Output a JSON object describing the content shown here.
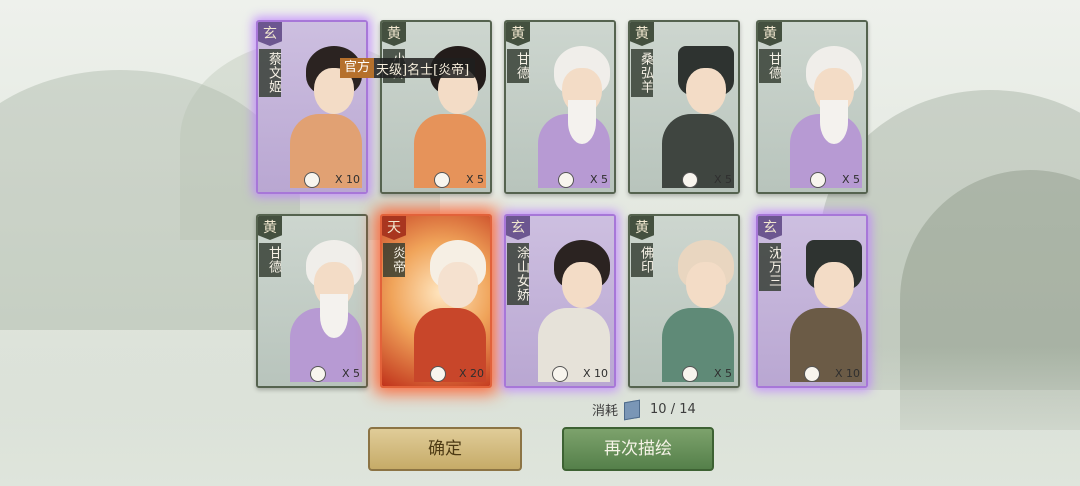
{
  "tooltip": {
    "tag": "官方",
    "text": "天级]名士[炎帝]"
  },
  "cards": [
    {
      "rank": "玄",
      "rarity": "xuan",
      "name": "蔡文姬",
      "qty": "X 10"
    },
    {
      "rank": "黄",
      "rarity": "huang",
      "name": "小妹",
      "qty": "X 5"
    },
    {
      "rank": "黄",
      "rarity": "huang",
      "name": "甘德",
      "qty": "X 5"
    },
    {
      "rank": "黄",
      "rarity": "huang",
      "name": "桑弘羊",
      "qty": "X 5"
    },
    {
      "rank": "黄",
      "rarity": "huang",
      "name": "甘德",
      "qty": "X 5"
    },
    {
      "rank": "黄",
      "rarity": "huang",
      "name": "甘德",
      "qty": "X 5"
    },
    {
      "rank": "天",
      "rarity": "tian",
      "name": "炎帝",
      "qty": "X 20"
    },
    {
      "rank": "玄",
      "rarity": "xuan",
      "name": "涂山女娇",
      "qty": "X 10"
    },
    {
      "rank": "黄",
      "rarity": "huang",
      "name": "佛印",
      "qty": "X 5"
    },
    {
      "rank": "玄",
      "rarity": "xuan",
      "name": "沈万三",
      "qty": "X 10"
    }
  ],
  "cost": {
    "label": "消耗",
    "value": "10 / 14",
    "icon": "book-icon"
  },
  "buttons": {
    "confirm": "确定",
    "redraw": "再次描绘"
  },
  "colors": {
    "xuan_glow": "#a777d8",
    "tian_glow": "#e2623a",
    "huang_frame": "#55634f",
    "confirm": "#d2ba80",
    "redraw": "#66914f"
  }
}
